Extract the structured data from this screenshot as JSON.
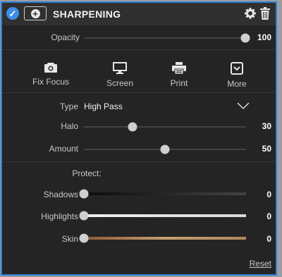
{
  "header": {
    "title": "SHARPENING",
    "enabled": true,
    "check_icon": "check-circle-icon",
    "add_icon": "plus-circle-icon",
    "gear_icon": "gear-icon",
    "trash_icon": "trash-icon"
  },
  "opacity": {
    "label": "Opacity",
    "value": "100",
    "level": 100,
    "max": 100
  },
  "presets": [
    {
      "label": "Fix Focus",
      "icon": "camera-icon"
    },
    {
      "label": "Screen",
      "icon": "monitor-icon"
    },
    {
      "label": "Print",
      "icon": "printer-icon"
    },
    {
      "label": "More",
      "icon": "chevron-box-icon"
    }
  ],
  "type": {
    "label": "Type",
    "value": "High Pass"
  },
  "halo": {
    "label": "Halo",
    "value": "30",
    "level": 30,
    "max": 100
  },
  "amount": {
    "label": "Amount",
    "value": "50",
    "level": 50,
    "max": 100
  },
  "protect": {
    "heading": "Protect:",
    "shadows": {
      "label": "Shadows",
      "value": "0",
      "level": 0,
      "max": 100
    },
    "highlights": {
      "label": "Highlights",
      "value": "0",
      "level": 0,
      "max": 100
    },
    "skin": {
      "label": "Skin",
      "value": "0",
      "level": 0,
      "max": 100
    }
  },
  "reset_label": "Reset",
  "colors": {
    "accent": "#2b7fd8",
    "panel_bg": "#242424",
    "skin_track": "#a07a4a"
  }
}
